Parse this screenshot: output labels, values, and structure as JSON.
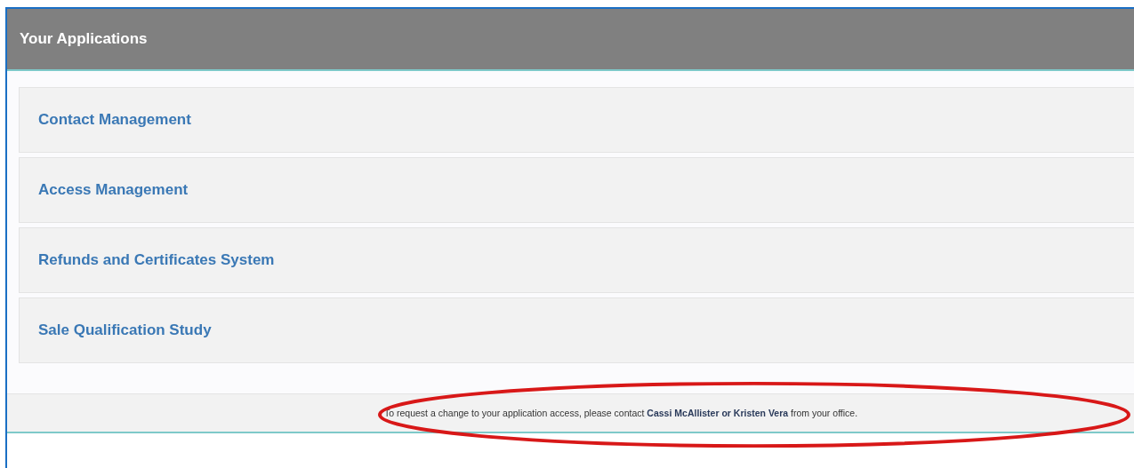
{
  "panel": {
    "title": "Your Applications"
  },
  "applications": [
    {
      "label": "Contact Management"
    },
    {
      "label": "Access Management"
    },
    {
      "label": "Refunds and Certificates System"
    },
    {
      "label": "Sale Qualification Study"
    }
  ],
  "footer": {
    "note": "To request a change to your application access, please contact **Cassi McAllister or Kristen Vera** from your office."
  }
}
